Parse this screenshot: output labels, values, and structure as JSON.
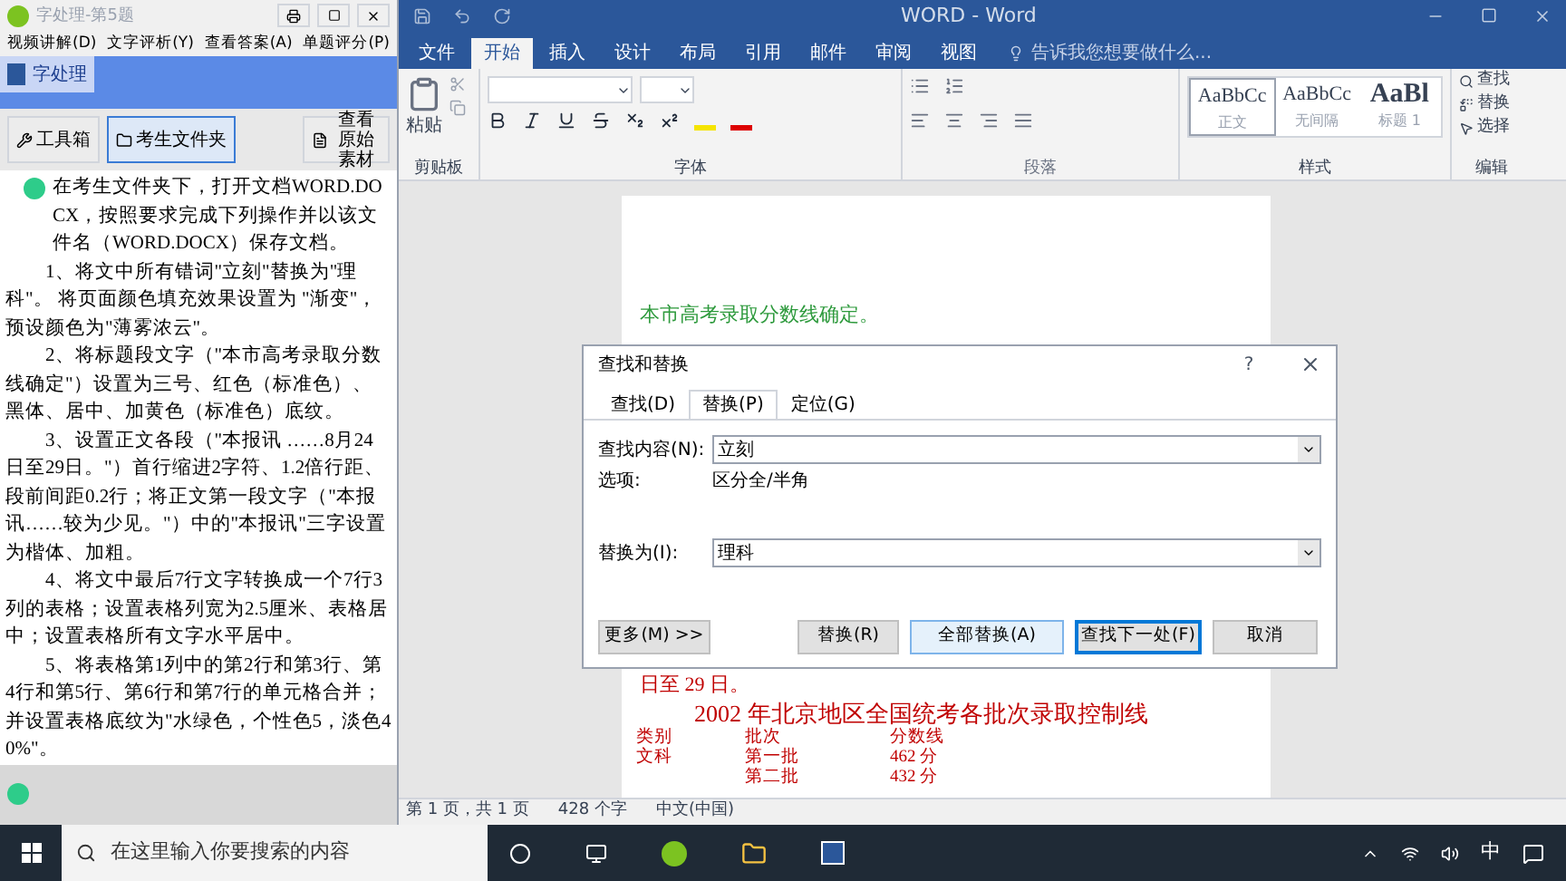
{
  "side_window": {
    "title": "字处理-第5题",
    "menu": [
      "视频讲解(D)",
      "文字评析(Y)",
      "查看答案(A)",
      "单题评分(P)"
    ],
    "banner_tab": "字处理",
    "tools": [
      {
        "label": "工具箱",
        "selected": false
      },
      {
        "label": "考生文件夹",
        "selected": true
      },
      {
        "label": "查看原始素材",
        "selected": false
      }
    ],
    "task": [
      "在考生文件夹下，打开文档WORD.DOCX，按照要求完成下列操作并以该文件名（WORD.DOCX）保存文档。",
      "1、将文中所有错词\"立刻\"替换为\"理科\"。 将页面颜色填充效果设置为 \"渐变\"，预设颜色为\"薄雾浓云\"。",
      "2、将标题段文字（\"本市高考录取分数线确定\"）设置为三号、红色（标准色）、黑体、居中、加黄色（标准色）底纹。",
      "3、设置正文各段（\"本报讯 ……8月24日至29日。\"）首行缩进2字符、1.2倍行距、段前间距0.2行；将正文第一段文字（\"本报讯……较为少见。\"）中的\"本报讯\"三字设置为楷体、加粗。",
      "4、将文中最后7行文字转换成一个7行3列的表格；设置表格列宽为2.5厘米、表格居中；设置表格所有文字水平居中。",
      "5、将表格第1列中的第2行和第3行、第4行和第5行、第6行和第7行的单元格合并；并设置表格底纹为\"水绿色，个性色5，淡色40%\"。"
    ]
  },
  "word": {
    "title": "WORD - Word",
    "tabs": [
      {
        "label": "文件",
        "selected": false
      },
      {
        "label": "开始",
        "selected": true
      },
      {
        "label": "插入",
        "selected": false
      },
      {
        "label": "设计",
        "selected": false
      },
      {
        "label": "布局",
        "selected": false
      },
      {
        "label": "引用",
        "selected": false
      },
      {
        "label": "邮件",
        "selected": false
      },
      {
        "label": "审阅",
        "selected": false
      },
      {
        "label": "视图",
        "selected": false
      }
    ],
    "tell_me": "告诉我您想要做什么...",
    "paste": "粘贴",
    "groups": [
      "剪贴板",
      "字体",
      "段落",
      "样式",
      "编辑"
    ],
    "styles": [
      {
        "sample": "AaBbCc",
        "name": "正文",
        "selected": true
      },
      {
        "sample": "AaBbCc",
        "name": "无间隔",
        "selected": false
      },
      {
        "sample": "AaBl",
        "name": "标题 1",
        "selected": false
      }
    ],
    "editing": [
      "查找",
      "替换",
      "选择"
    ],
    "doc": {
      "heading": "本市高考录取分数线确定。",
      "partial_line": "日至 29 日。",
      "title": "2002 年北京地区全国统考各批次录取控制线",
      "rows": [
        [
          "类别",
          "批次",
          "分数线"
        ],
        [
          "文科",
          "第一批",
          "462 分"
        ],
        [
          "",
          "第二批",
          "432 分"
        ]
      ]
    },
    "status": [
      "第 1 页，共 1 页",
      "428 个字",
      "中文(中国)"
    ]
  },
  "dialog": {
    "title": "查找和替换",
    "help": "?",
    "tabs": [
      {
        "label": "查找(D)",
        "selected": false
      },
      {
        "label": "替换(P)",
        "selected": true
      },
      {
        "label": "定位(G)",
        "selected": false
      }
    ],
    "find_label": "查找内容(N):",
    "find_value": "立刻",
    "options_label": "选项:",
    "options_value": "区分全/半角",
    "replace_label": "替换为(I):",
    "replace_value": "理科",
    "buttons": [
      {
        "label": "更多(M) >>",
        "kind": "normal"
      },
      {
        "label": "替换(R)",
        "kind": "normal"
      },
      {
        "label": "全部替换(A)",
        "kind": "hover"
      },
      {
        "label": "查找下一处(F)",
        "kind": "default"
      },
      {
        "label": "取消",
        "kind": "normal"
      }
    ]
  },
  "taskbar": {
    "search_placeholder": "在这里输入你要搜索的内容",
    "ime": "中"
  }
}
